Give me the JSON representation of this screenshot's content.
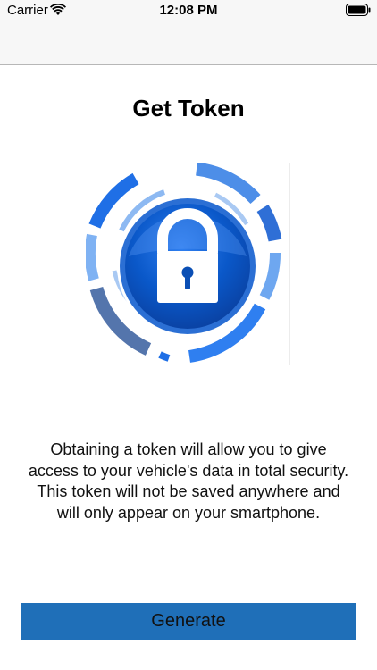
{
  "status_bar": {
    "carrier": "Carrier",
    "time": "12:08 PM",
    "wifi_icon": "wifi-icon",
    "battery_icon": "battery-icon"
  },
  "page": {
    "title": "Get Token",
    "illustration_icon": "security-lock-icon",
    "description": "Obtaining a token will allow you to give access to your vehicle's data in total security. This token will not be saved anywhere and will only appear on your smartphone."
  },
  "actions": {
    "generate_label": "Generate"
  },
  "colors": {
    "button_background": "#1f6fb8",
    "nav_background": "#f7f7f7",
    "lock_blue": "#0a58c9"
  }
}
